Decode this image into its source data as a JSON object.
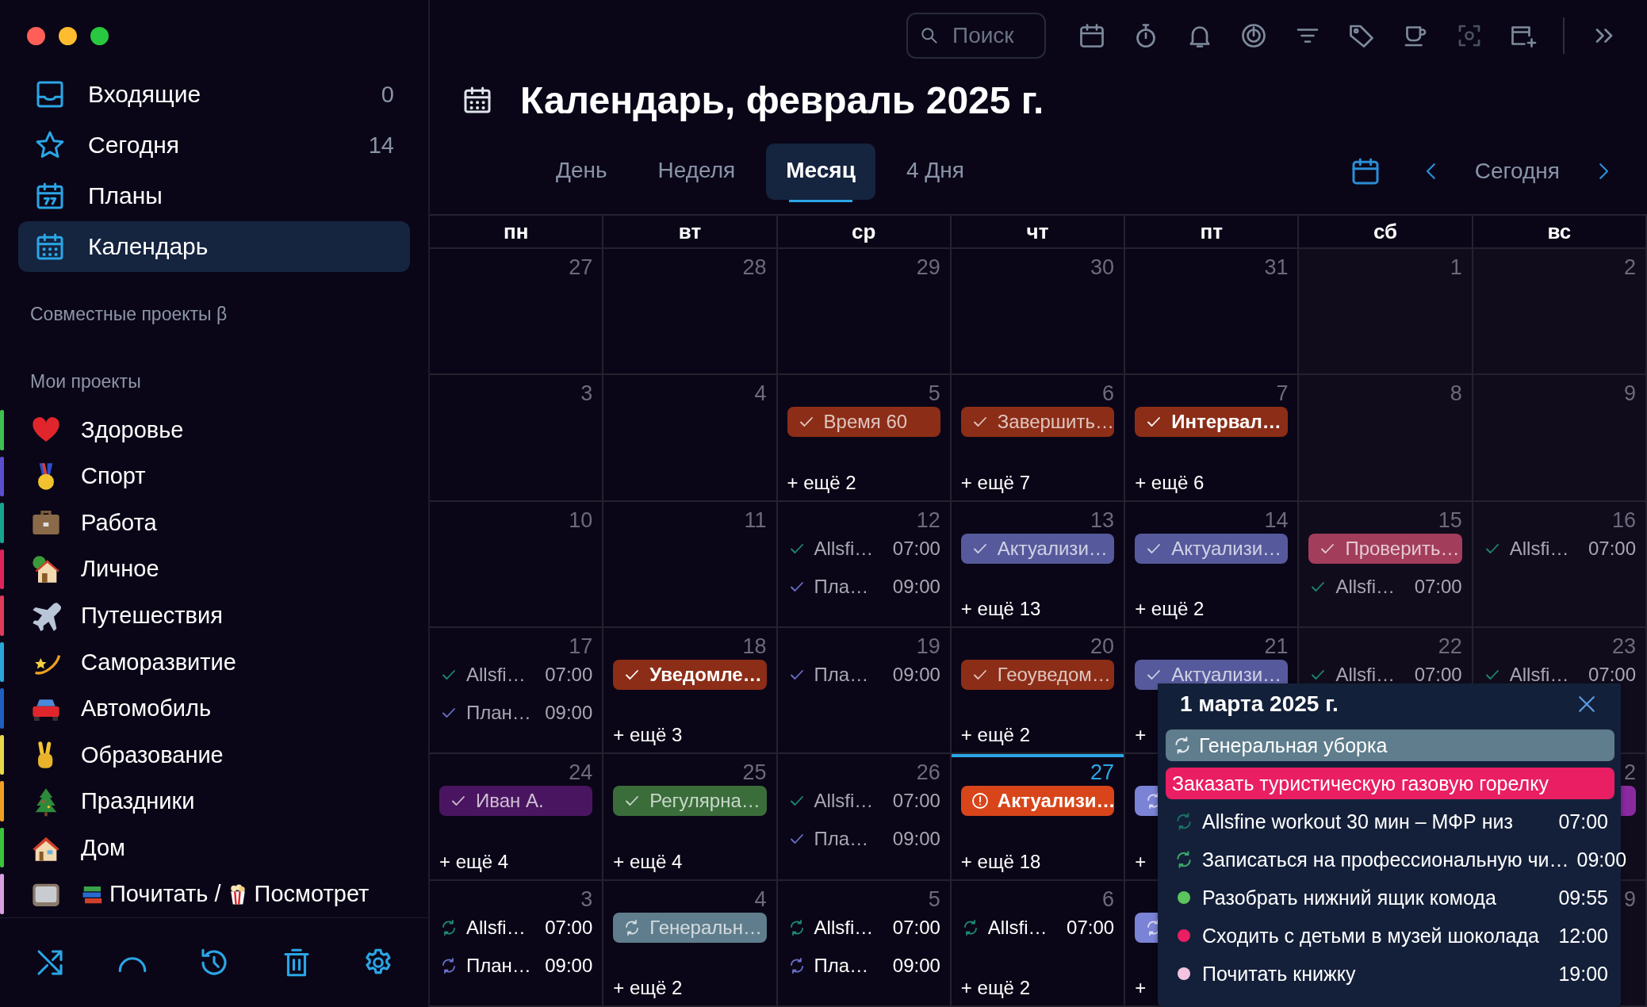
{
  "window": {
    "controls": [
      {
        "color": "#ff5f57"
      },
      {
        "color": "#febc2e"
      },
      {
        "color": "#28c840"
      }
    ]
  },
  "sidebar": {
    "nav": [
      {
        "kind": "inbox",
        "label": "Входящие",
        "count": "0",
        "selected": false
      },
      {
        "kind": "today",
        "label": "Сегодня",
        "count": "14",
        "selected": false
      },
      {
        "kind": "plans",
        "label": "Планы",
        "selected": false
      },
      {
        "kind": "calendar",
        "label": "Календарь",
        "selected": true
      }
    ],
    "shared_heading": "Совместные проекты β",
    "projects_heading": "Мои проекты",
    "projects": [
      {
        "kind": "heart",
        "label": "Здоровье",
        "color": "#3fbf4f"
      },
      {
        "kind": "medal",
        "label": "Спорт",
        "color": "#5a4fcf"
      },
      {
        "kind": "briefcase",
        "label": "Работа",
        "color": "#18a58f"
      },
      {
        "kind": "cottage",
        "label": "Личное",
        "color": "#e0245e"
      },
      {
        "kind": "plane",
        "label": "Путешествия",
        "color": "#e23a5a"
      },
      {
        "kind": "comet",
        "label": "Саморазвитие",
        "color": "#2aa7d8"
      },
      {
        "kind": "car",
        "label": "Автомобиль",
        "color": "#1f5fbf"
      },
      {
        "kind": "hand",
        "label": "Образование",
        "color": "#e8d84a"
      },
      {
        "kind": "tree",
        "label": "Праздники",
        "color": "#f0a020"
      },
      {
        "kind": "house",
        "label": "Дом",
        "color": "#3bc43b"
      },
      {
        "kind": "tv",
        "color": "#d9a0e0",
        "segments": [
          {
            "kind": "books"
          },
          {
            "kind": "text",
            "text": "Почитать /"
          },
          {
            "kind": "popcorn"
          },
          {
            "kind": "text",
            "text": "Посмотрет"
          }
        ]
      }
    ]
  },
  "toolbar": {
    "search": {
      "placeholder": "Поиск"
    }
  },
  "title": "Календарь, февраль 2025 г.",
  "tabs": [
    {
      "label": "День",
      "selected": false
    },
    {
      "label": "Неделя",
      "selected": false
    },
    {
      "label": "Месяц",
      "selected": true
    },
    {
      "label": "4 Дня",
      "selected": false
    }
  ],
  "today_button": "Сегодня",
  "calendar": {
    "columns": [
      "пн",
      "вт",
      "ср",
      "чт",
      "пт",
      "сб",
      "вс"
    ],
    "weeks": [
      {
        "days": [
          {
            "date": "27"
          },
          {
            "date": "28"
          },
          {
            "date": "29"
          },
          {
            "date": "30"
          },
          {
            "date": "31"
          }
        ],
        "sat": {
          "date": "1"
        },
        "sun": {
          "date": "2"
        }
      },
      {
        "days": [
          {
            "date": "3"
          },
          {
            "date": "4"
          },
          {
            "date": "5",
            "items": [
              {
                "kind": "pill",
                "label": "Время 60",
                "color": "#8c2d17",
                "done": true,
                "bold": false
              }
            ],
            "more": "+ ещё 2"
          },
          {
            "date": "6",
            "items": [
              {
                "kind": "pill",
                "label": "Завершить…",
                "color": "#8c2d17",
                "done": true,
                "bold": false
              }
            ],
            "more": "+ ещё 7"
          },
          {
            "date": "7",
            "items": [
              {
                "kind": "pill",
                "label": "Интервал…",
                "color": "#8c2d17",
                "done": true,
                "bold": true
              }
            ],
            "more": "+ ещё 6"
          }
        ],
        "sat": {
          "date": "8"
        },
        "sun": {
          "date": "9"
        }
      },
      {
        "days": [
          {
            "date": "10"
          },
          {
            "date": "11"
          },
          {
            "date": "12",
            "items": [
              {
                "kind": "line",
                "label": "Allsfi…",
                "time": "07:00",
                "color": "#1d8a72",
                "done": true
              },
              {
                "kind": "line",
                "label": "Пла…",
                "time": "09:00",
                "color": "#6a70c8",
                "done": true
              }
            ]
          },
          {
            "date": "13",
            "items": [
              {
                "kind": "pill",
                "label": "Актуализи…",
                "color": "#565a9c",
                "done": true,
                "bold": false
              }
            ],
            "more": "+ ещё 13"
          },
          {
            "date": "14",
            "items": [
              {
                "kind": "pill",
                "label": "Актуализи…",
                "color": "#565a9c",
                "done": true,
                "bold": false
              }
            ],
            "more": "+ ещё 2"
          }
        ],
        "sat": {
          "date": "15",
          "items": [
            {
              "kind": "pill",
              "label": "Проверить…",
              "color": "#a23d5c",
              "done": true,
              "bold": false
            },
            {
              "kind": "line",
              "label": "Allsfi…",
              "time": "07:00",
              "color": "#1d8a72",
              "done": true
            }
          ]
        },
        "sun": {
          "date": "16",
          "items": [
            {
              "kind": "line",
              "label": "Allsfi…",
              "time": "07:00",
              "color": "#1d8a72",
              "done": true
            }
          ]
        }
      },
      {
        "days": [
          {
            "date": "17",
            "items": [
              {
                "kind": "line",
                "label": "Allsfi…",
                "time": "07:00",
                "color": "#1d8a72",
                "done": true
              },
              {
                "kind": "line",
                "label": "План…",
                "time": "09:00",
                "color": "#6a70c8",
                "done": true
              }
            ]
          },
          {
            "date": "18",
            "items": [
              {
                "kind": "pill",
                "label": "Уведомле…",
                "color": "#8c2d17",
                "done": true,
                "bold": true
              }
            ],
            "more": "+ ещё 3"
          },
          {
            "date": "19",
            "items": [
              {
                "kind": "line",
                "label": "Пла…",
                "time": "09:00",
                "color": "#6a70c8",
                "done": true
              }
            ]
          },
          {
            "date": "20",
            "items": [
              {
                "kind": "pill",
                "label": "Геоуведом…",
                "color": "#8c2d17",
                "done": true,
                "bold": false
              }
            ],
            "more": "+ ещё 2"
          },
          {
            "date": "21",
            "items": [
              {
                "kind": "pill",
                "label": "Актуализи…",
                "color": "#565a9c",
                "done": true,
                "bold": false
              }
            ],
            "more": "+"
          }
        ],
        "sat": {
          "date": "22",
          "items": [
            {
              "kind": "line",
              "label": "Allsfi…",
              "time": "07:00",
              "color": "#1d8a72",
              "done": true
            }
          ]
        },
        "sun": {
          "date": "23",
          "items": [
            {
              "kind": "line",
              "label": "Allsfi…",
              "time": "07:00",
              "color": "#1d8a72",
              "done": true
            }
          ]
        }
      },
      {
        "days": [
          {
            "date": "24",
            "items": [
              {
                "kind": "pill",
                "label": "Иван А.",
                "color": "#4a1560",
                "done": true,
                "bold": false
              }
            ],
            "more": "+ ещё 4"
          },
          {
            "date": "25",
            "items": [
              {
                "kind": "pill",
                "label": "Регулярна…",
                "color": "#3a6d3a",
                "done": true,
                "bold": false
              }
            ],
            "more": "+ ещё 4"
          },
          {
            "date": "26",
            "items": [
              {
                "kind": "line",
                "label": "Allsfi…",
                "time": "07:00",
                "color": "#1d8a72",
                "done": true
              },
              {
                "kind": "line",
                "label": "Пла…",
                "time": "09:00",
                "color": "#6a70c8",
                "done": true
              }
            ]
          },
          {
            "date": "27",
            "today": true,
            "items": [
              {
                "kind": "pill",
                "label": "Актуализи…",
                "color": "#d8451a",
                "overdue": true,
                "bold": true
              }
            ],
            "more": "+ ещё 18"
          },
          {
            "items": [
              {
                "kind": "pill",
                "color": "#7b83d6",
                "done": false
              }
            ],
            "more": "+"
          }
        ],
        "sun": {
          "date": "2",
          "items": [
            {
              "kind": "pill",
              "color": "#8a2aa0"
            }
          ]
        }
      },
      {
        "days": [
          {
            "date": "3",
            "items": [
              {
                "kind": "line",
                "label": "Allsfi…",
                "time": "07:00",
                "color": "#1d8a72",
                "done": false
              },
              {
                "kind": "line",
                "label": "План…",
                "time": "09:00",
                "color": "#6a70c8",
                "done": false
              }
            ]
          },
          {
            "date": "4",
            "items": [
              {
                "kind": "pill",
                "label": "Генеральн…",
                "color": "#5f7d8c",
                "done": false,
                "bold": false
              }
            ],
            "more": "+ ещё 2"
          },
          {
            "date": "5",
            "items": [
              {
                "kind": "line",
                "label": "Allsfi…",
                "time": "07:00",
                "color": "#1d8a72",
                "done": false
              },
              {
                "kind": "line",
                "label": "Пла…",
                "time": "09:00",
                "color": "#6a70c8",
                "done": false
              }
            ]
          },
          {
            "date": "6",
            "items": [
              {
                "kind": "line",
                "label": "Allsfi…",
                "time": "07:00",
                "color": "#1d8a72",
                "done": false
              }
            ],
            "more": "+ ещё 2"
          },
          {
            "items": [
              {
                "kind": "pill",
                "color": "#7b83d6",
                "done": false
              }
            ],
            "more": "+"
          }
        ],
        "sun": {
          "date": "9"
        }
      }
    ]
  },
  "popup": {
    "title": "1 марта 2025 г.",
    "items": [
      {
        "kind": "bar",
        "label": "Генеральная уборка",
        "color": "#5f7d8c",
        "recurring": true
      },
      {
        "kind": "bar",
        "label": "Заказать туристическую газовую горелку",
        "color": "#e91e63",
        "recurring": false
      },
      {
        "kind": "recurring",
        "label": "Allsfine workout 30 мин – МФР низ",
        "time": "07:00",
        "color": "#1d6e62"
      },
      {
        "kind": "recurring",
        "label": "Записаться на профессиональную чи…",
        "time": "09:00",
        "color": "#3aa86a"
      },
      {
        "kind": "task",
        "label": "Разобрать нижний ящик комода",
        "time": "09:55",
        "color": "#5cc45c"
      },
      {
        "kind": "task",
        "label": "Сходить с детьми в музей шоколада",
        "time": "12:00",
        "color": "#e91e63"
      },
      {
        "kind": "task",
        "label": "Почитать книжку",
        "time": "19:00",
        "color": "#f3c4e0"
      }
    ]
  }
}
